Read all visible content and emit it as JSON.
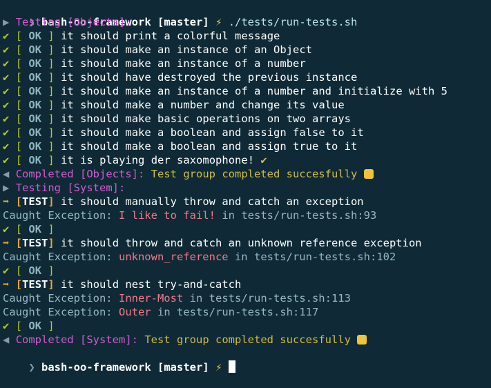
{
  "prompt": {
    "chevron": "❯",
    "repo": "bash-oo-framework",
    "branch": "[master]",
    "bolt": "⚡",
    "command": "./tests/run-tests.sh"
  },
  "groups": [
    {
      "testing": "Testing [Objects]:",
      "tests": [
        "it should print a colorful message",
        "it should make an instance of an Object",
        "it should make an instance of a number",
        "it should have destroyed the previous instance",
        "it should make an instance of a number and initialize with 5",
        "it should make a number and change its value",
        "it should make basic operations on two arrays",
        "it should make a boolean and assign false to it",
        "it should make a boolean and assign true to it",
        "it is playing der saxomophone!"
      ],
      "completed_label": "Completed [Objects]:",
      "completed_msg": "Test group completed succesfully"
    },
    {
      "testing": "Testing [System]:",
      "completed_label": "Completed [System]:",
      "completed_msg": "Test group completed succesfully"
    }
  ],
  "labels": {
    "check": "✔",
    "ok_open": "[",
    "ok": "OK",
    "ok_close": "]",
    "arrow": "➡",
    "test": "TEST",
    "caught": "Caught Exception:",
    "in": "in",
    "tick": "✔"
  },
  "system_tests": [
    {
      "name": "it should manually throw and catch an exception",
      "exceptions": [
        {
          "msg": "I like to fail!",
          "loc": "tests/run-tests.sh:93"
        }
      ]
    },
    {
      "name": "it should throw and catch an unknown reference exception",
      "exceptions": [
        {
          "msg": "unknown_reference",
          "loc": "tests/run-tests.sh:102"
        }
      ]
    },
    {
      "name": "it should nest try-and-catch",
      "exceptions": [
        {
          "msg": "Inner-Most",
          "loc": "tests/run-tests.sh:113"
        },
        {
          "msg": "Outer",
          "loc": "tests/run-tests.sh:117"
        }
      ]
    }
  ],
  "colors": {
    "background": "#0f2a36",
    "ok_green": "#b7c82c",
    "magenta": "#d05bd0",
    "yellow": "#d3bb45",
    "orange": "#e9a53a",
    "error_pink": "#f07a8a"
  }
}
